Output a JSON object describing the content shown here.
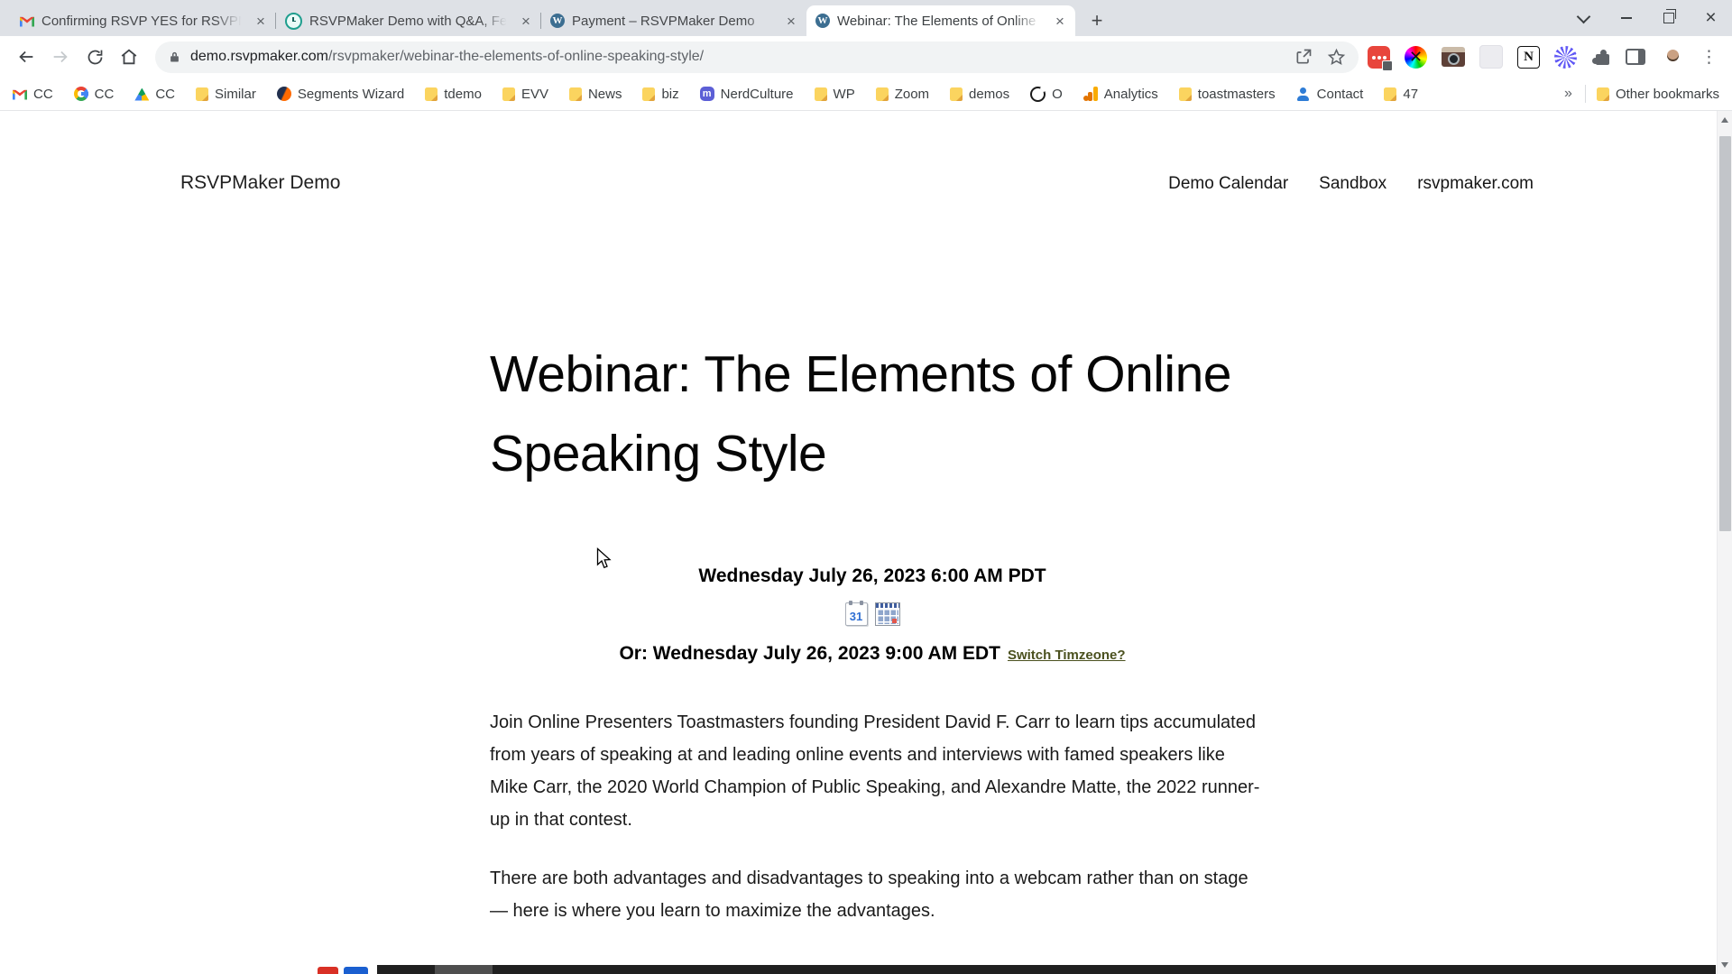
{
  "browser": {
    "tabs": [
      {
        "title": "Confirming RSVP YES for RSVPM",
        "icon": "gmail-icon"
      },
      {
        "title": "RSVPMaker Demo with Q&A, Fea",
        "icon": "alarm-clock-icon"
      },
      {
        "title": "Payment – RSVPMaker Demo",
        "icon": "wordpress-icon"
      },
      {
        "title": "Webinar: The Elements of Online",
        "icon": "wordpress-icon"
      }
    ],
    "glyphs": {
      "close": "×",
      "new_tab": "+",
      "menu": "⋮",
      "overflow": "»",
      "wheel_cross": "✕",
      "wordpress_w": "W",
      "notion_n": "N",
      "mastodon_m": "m"
    },
    "url": {
      "domain": "demo.rsvpmaker.com",
      "path": "/rsvpmaker/webinar-the-elements-of-online-speaking-style/"
    },
    "bookmarks": [
      {
        "icon": "gmail-icon",
        "label": "CC"
      },
      {
        "icon": "google-icon",
        "label": "CC"
      },
      {
        "icon": "drive-icon",
        "label": "CC"
      },
      {
        "icon": "folder-icon",
        "label": "Similar"
      },
      {
        "icon": "similarweb-icon",
        "label": "Segments Wizard"
      },
      {
        "icon": "folder-icon",
        "label": "tdemo"
      },
      {
        "icon": "folder-icon",
        "label": "EVV"
      },
      {
        "icon": "folder-icon",
        "label": "News"
      },
      {
        "icon": "folder-icon",
        "label": "biz"
      },
      {
        "icon": "mastodon-icon",
        "label": "NerdCulture"
      },
      {
        "icon": "folder-icon",
        "label": "WP"
      },
      {
        "icon": "folder-icon",
        "label": "Zoom"
      },
      {
        "icon": "folder-icon",
        "label": "demos"
      },
      {
        "icon": "ring-icon",
        "label": "O"
      },
      {
        "icon": "analytics-icon",
        "label": "Analytics"
      },
      {
        "icon": "folder-icon",
        "label": "toastmasters"
      },
      {
        "icon": "person-icon",
        "label": "Contact"
      },
      {
        "icon": "folder-icon",
        "label": "47"
      }
    ],
    "other_bookmarks": "Other bookmarks"
  },
  "page": {
    "site_title": "RSVPMaker Demo",
    "nav": [
      {
        "label": "Demo Calendar"
      },
      {
        "label": "Sandbox"
      },
      {
        "label": "rsvpmaker.com"
      }
    ],
    "event_title": "Webinar: The Elements of Online Speaking Style",
    "datetime_primary": "Wednesday July 26, 2023 6:00 AM PDT",
    "datetime_alt": "Or: Wednesday July 26, 2023 9:00 AM EDT",
    "switch_timezone_label": "Switch Timzeone?",
    "calendar_day": "31",
    "paragraph1": "Join Online Presenters Toastmasters founding President David F. Carr to learn tips accumulated from years of speaking at and leading online events and interviews with famed speakers like Mike Carr, the 2020 World Champion of Public Speaking, and Alexandre Matte, the 2022 runner-up in that contest.",
    "paragraph2": "There are both advantages and disadvantages to speaking into a webcam rather than on stage — here is where you learn to maximize the advantages."
  },
  "colors": {
    "timezone_link": "#4b511f",
    "wordpress_blue": "#3c6e91",
    "chrome_tabstrip": "#dee1e6",
    "omnibox_bg": "#f1f3f4"
  }
}
